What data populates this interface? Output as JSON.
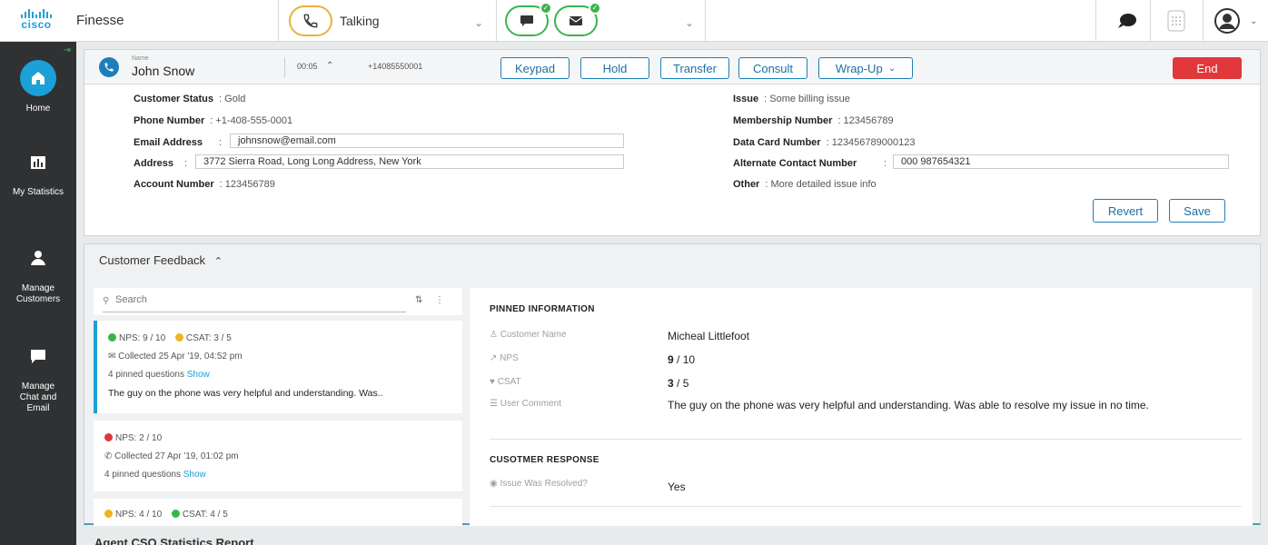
{
  "topbar": {
    "brand": "cisco",
    "app_name": "Finesse",
    "agent_state": "Talking",
    "state_icon": "phone-icon",
    "media_icons": [
      "chat-icon",
      "email-icon"
    ],
    "right_icons": [
      "chat-bubble-icon",
      "dialpad-icon",
      "user-avatar-icon"
    ],
    "colors": {
      "accent": "#1ba0d7",
      "talking": "#e8b33b",
      "ready": "#38b54a"
    }
  },
  "sidebar": {
    "items": [
      {
        "label": "Home",
        "icon": "home-icon",
        "active": true
      },
      {
        "label": "My Statistics",
        "icon": "bar-chart-icon",
        "active": false
      },
      {
        "label": "Manage Customers",
        "icon": "person-icon",
        "active": false
      },
      {
        "label": "Manage Chat and Email",
        "icon": "chat-icon",
        "active": false
      }
    ]
  },
  "call": {
    "name_label": "Name",
    "name": "John Snow",
    "timer": "00:05",
    "dialed_number": "+14085550001",
    "buttons": {
      "keypad": "Keypad",
      "hold": "Hold",
      "transfer": "Transfer",
      "consult": "Consult",
      "wrapup": "Wrap-Up",
      "end": "End"
    },
    "fields": {
      "customer_status_label": "Customer Status",
      "customer_status": "Gold",
      "phone_label": "Phone Number",
      "phone": "+1-408-555-0001",
      "email_label": "Email Address",
      "email": "johnsnow@email.com",
      "address_label": "Address",
      "address": "3772 Sierra Road, Long Long Address, New York",
      "account_label": "Account Number",
      "account": "123456789",
      "issue_label": "Issue",
      "issue": "Some billing issue",
      "membership_label": "Membership Number",
      "membership": "123456789",
      "datacard_label": "Data Card Number",
      "datacard": "123456789000123",
      "alt_contact_label": "Alternate Contact Number",
      "alt_contact": "000 987654321",
      "other_label": "Other",
      "other": "More detailed issue info"
    },
    "revert": "Revert",
    "save": "Save"
  },
  "feedback": {
    "title": "Customer Feedback",
    "search_placeholder": "Search",
    "cards": [
      {
        "nps": "NPS: 9 / 10",
        "nps_color": "#38b54a",
        "csat": "CSAT: 3 / 5",
        "csat_color": "#f0b323",
        "collected": "Collected 25 Apr '19, 04:52 pm",
        "pinned": "4 pinned questions",
        "show": "Show",
        "comment": "The guy on the phone was very helpful and understanding. Was.."
      },
      {
        "nps": "NPS: 2 / 10",
        "nps_color": "#e0383b",
        "collected": "Collected 27 Apr '19, 01:02 pm",
        "pinned": "4 pinned questions",
        "show": "Show"
      },
      {
        "nps": "NPS: 4 / 10",
        "nps_color": "#f0b323",
        "csat": "CSAT: 4 / 5",
        "csat_color": "#38b54a"
      }
    ],
    "detail": {
      "pinned_title": "PINNED INFORMATION",
      "customer_name_label": "Customer Name",
      "customer_name": "Micheal Littlefoot",
      "nps_label": "NPS",
      "nps_value": "9",
      "nps_max": "/ 10",
      "csat_label": "CSAT",
      "csat_value": "3",
      "csat_max": "/ 5",
      "comment_label": "User Comment",
      "comment": "The guy on the phone was very helpful and understanding. Was able to resolve my issue in no time.",
      "response_title": "CUSOTMER RESPONSE",
      "resolved_label": "Issue Was Resolved?",
      "resolved_value": "Yes"
    }
  },
  "bottom": {
    "title": "Agent CSQ Statistics Report"
  }
}
